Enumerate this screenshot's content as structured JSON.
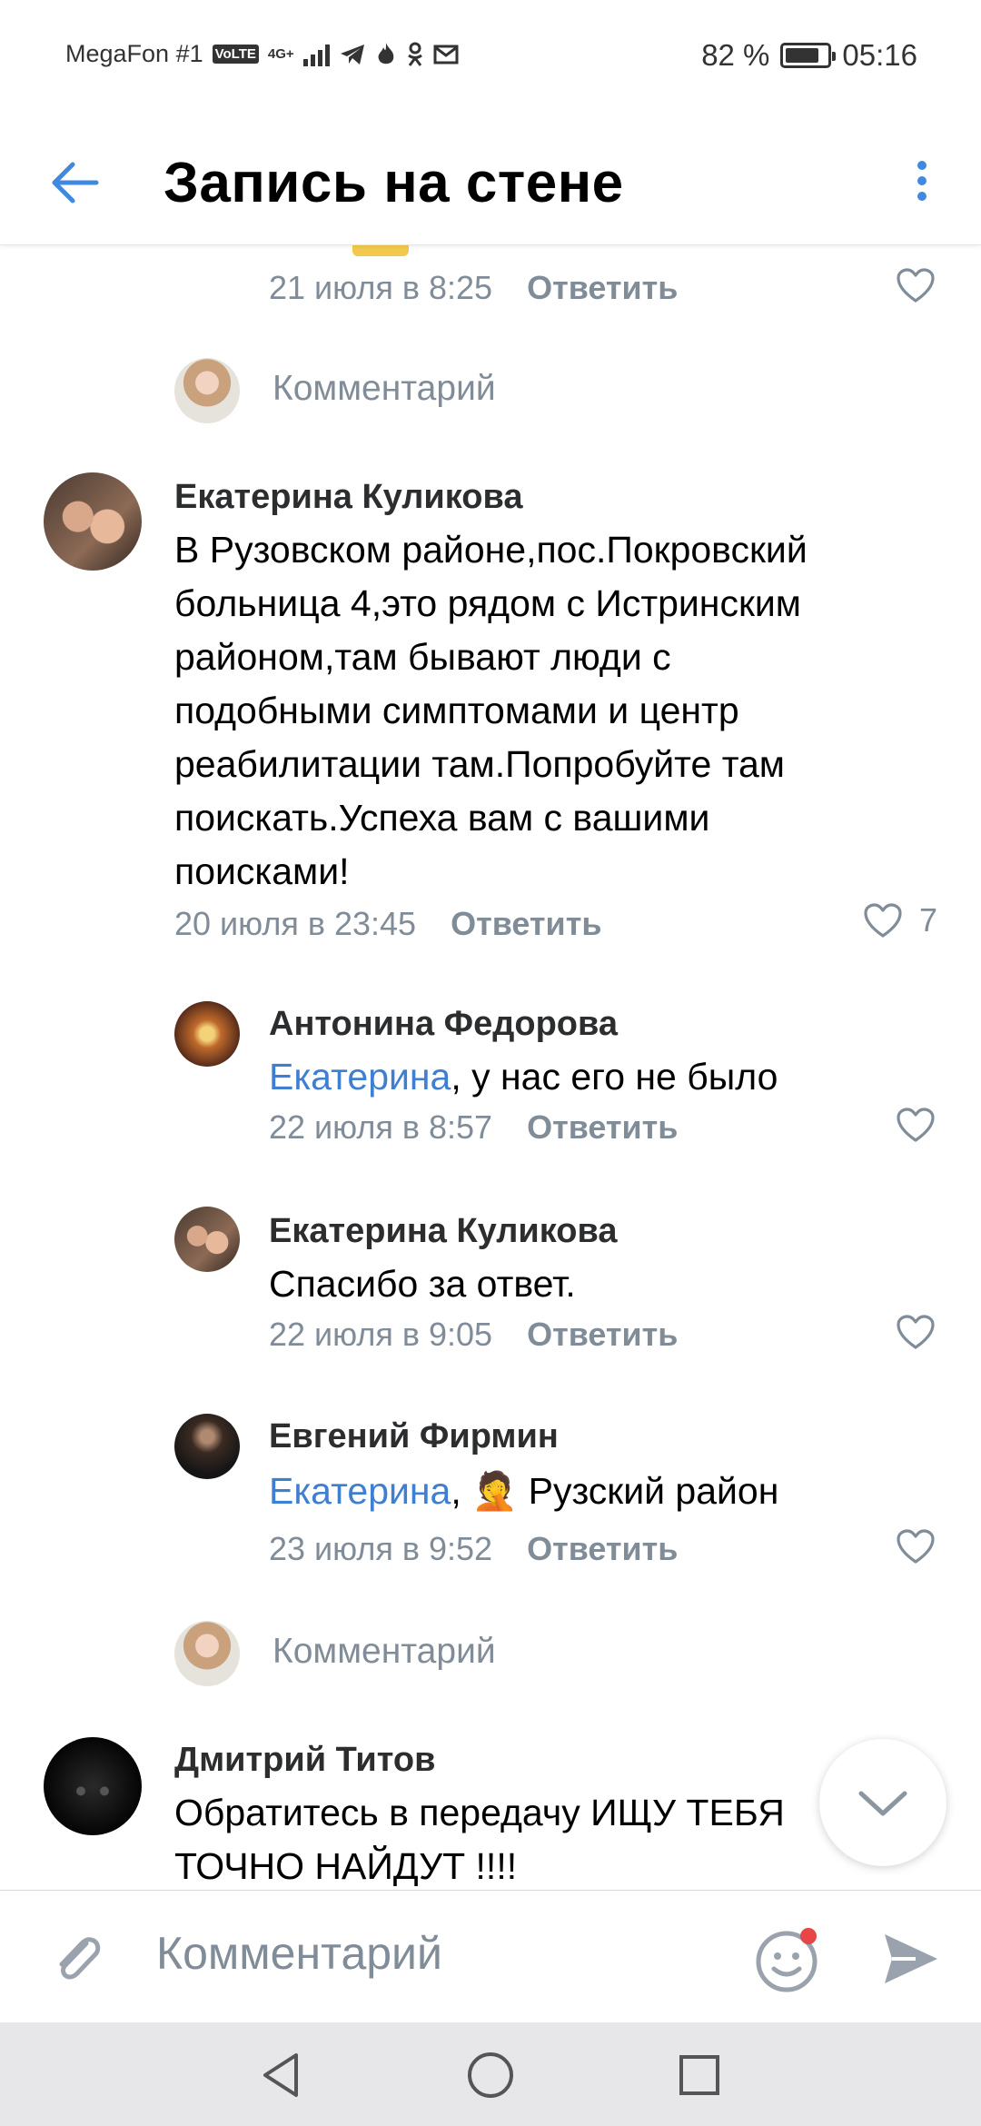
{
  "status_bar": {
    "carrier": "MegaFon #1",
    "volte": "VoLTE",
    "network": "4G+",
    "battery_percent": "82 %",
    "battery_level": 0.82,
    "time": "05:16"
  },
  "header": {
    "title": "Запись на стене"
  },
  "colors": {
    "accent": "#3f8ae0",
    "secondary_text": "#818c99",
    "mention": "#3f7fd2"
  },
  "comments": [
    {
      "date": "21 июля в 8:25",
      "reply_label": "Ответить"
    },
    {
      "placeholder": "Комментарий"
    },
    {
      "author": "Екатерина Куликова",
      "lines": [
        "В Рузовском районе,пос.Покровский",
        "больница 4,это рядом с Истринским",
        "районом,там бывают люди с",
        "подобными симптомами и центр",
        "реабилитации там.Попробуйте там",
        "поискать.Успеха вам с вашими",
        "поисками!"
      ],
      "date": "20 июля в 23:45",
      "reply_label": "Ответить",
      "likes": "7"
    },
    {
      "author": "Антонина Федорова",
      "mention": "Екатерина",
      "text": ", у нас его не было",
      "date": "22 июля в 8:57",
      "reply_label": "Ответить"
    },
    {
      "author": "Екатерина Куликова",
      "text": "Спасибо за ответ.",
      "date": "22 июля в 9:05",
      "reply_label": "Ответить"
    },
    {
      "author": "Евгений Фирмин",
      "mention": "Екатерина",
      "text_prefix": ", ",
      "emoji": "🤦",
      "text": " Рузский район",
      "date": "23 июля в 9:52",
      "reply_label": "Ответить"
    },
    {
      "placeholder": "Комментарий"
    },
    {
      "author": "Дмитрий Титов",
      "lines": [
        "Обратитесь в передачу ИЩУ ТЕБЯ",
        "ТОЧНО НАЙДУТ !!!!"
      ]
    }
  ],
  "composer": {
    "placeholder": "Комментарий"
  }
}
